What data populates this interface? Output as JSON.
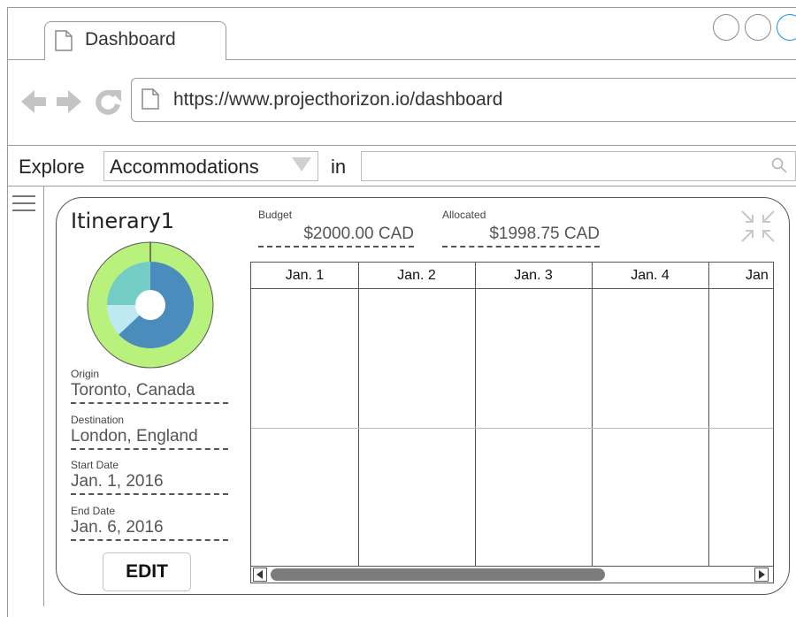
{
  "browser": {
    "tab_title": "Dashboard",
    "url": "https://www.projecthorizon.io/dashboard"
  },
  "explore_bar": {
    "explore_label": "Explore",
    "category_selected": "Accommodations",
    "in_label": "in",
    "search_value": ""
  },
  "itinerary": {
    "title": "Itinerary1",
    "budget": {
      "label": "Budget",
      "value": "$2000.00 CAD"
    },
    "allocated": {
      "label": "Allocated",
      "value": "$1998.75 CAD"
    },
    "fields": [
      {
        "label": "Origin",
        "value": "Toronto, Canada"
      },
      {
        "label": "Destination",
        "value": "London, England"
      },
      {
        "label": "Start Date",
        "value": "Jan. 1, 2016"
      },
      {
        "label": "End Date",
        "value": "Jan. 6, 2016"
      }
    ],
    "edit_label": "EDIT"
  },
  "calendar": {
    "columns": [
      "Jan. 1",
      "Jan. 2",
      "Jan. 3",
      "Jan. 4",
      "Jan"
    ]
  },
  "budget_donut": {
    "outer_ring_color": "#b8f27c",
    "inner_segments": [
      {
        "color": "#4a8cbc",
        "fraction": 0.63
      },
      {
        "color": "#bfe9f2",
        "fraction": 0.12
      },
      {
        "color": "#74ccc7",
        "fraction": 0.25
      }
    ]
  },
  "colors": {
    "window_accent": "#1a8ee8"
  }
}
